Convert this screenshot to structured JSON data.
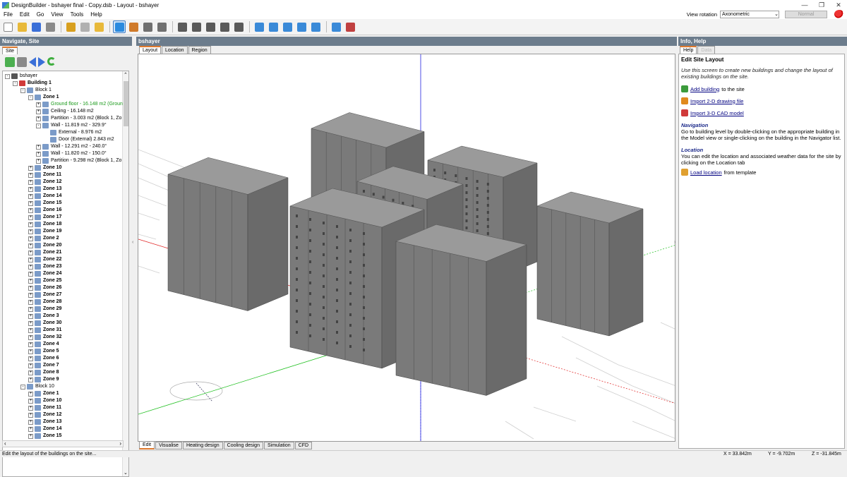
{
  "window": {
    "title": "DesignBuilder - bshayer final - Copy.dsb - Layout - bshayer",
    "controls": [
      "minimize-icon",
      "maximize-icon",
      "close-icon"
    ]
  },
  "menu": [
    "File",
    "Edit",
    "Go",
    "View",
    "Tools",
    "Help"
  ],
  "view_rotation": {
    "label": "View rotation",
    "value": "Axonometric",
    "mode_button": "Normal"
  },
  "toolbar": {
    "icons": [
      "new-icon",
      "open-icon",
      "save-icon",
      "print-icon",
      "wrench-icon",
      "eraser-icon",
      "lock-icon",
      "select-arrow-icon",
      "add-building-icon",
      "move-icon",
      "rotate-icon",
      "draw-line-icon",
      "measure-icon",
      "dimension-icon",
      "ruler-icon",
      "axis-icon",
      "orbit-icon",
      "zoom-in-icon",
      "zoom-window-icon",
      "zoom-extents-icon",
      "zoom-fit-icon",
      "screenshot-icon",
      "render-icon"
    ],
    "active_index": 7
  },
  "left_panel": {
    "header": "Navigate, Site",
    "tab": "Site",
    "tree": [
      {
        "depth": 0,
        "label": "bshayer",
        "exp": "-",
        "bold": false
      },
      {
        "depth": 1,
        "label": "Building 1",
        "exp": "-",
        "bold": true
      },
      {
        "depth": 2,
        "label": "Block 1",
        "exp": "-",
        "bold": false
      },
      {
        "depth": 3,
        "label": "Zone 1",
        "exp": "-",
        "bold": true
      },
      {
        "depth": 4,
        "label": "Ground floor - 16.148 m2 (Groun",
        "exp": "+",
        "bold": false,
        "green": true
      },
      {
        "depth": 4,
        "label": "Ceiling - 16.148 m2",
        "exp": "+",
        "bold": false
      },
      {
        "depth": 4,
        "label": "Partition - 3.003 m2 (Block 1, Zo",
        "exp": "+",
        "bold": false
      },
      {
        "depth": 4,
        "label": "Wall - 11.819 m2 - 329.9°",
        "exp": "-",
        "bold": false
      },
      {
        "depth": 5,
        "label": "External - 8.976 m2",
        "exp": "",
        "bold": false
      },
      {
        "depth": 5,
        "label": "Door (External) 2.843 m2",
        "exp": "",
        "bold": false
      },
      {
        "depth": 4,
        "label": "Wall - 12.291 m2 - 240.0°",
        "exp": "+",
        "bold": false
      },
      {
        "depth": 4,
        "label": "Wall - 11.820 m2 - 150.0°",
        "exp": "+",
        "bold": false
      },
      {
        "depth": 4,
        "label": "Partition - 9.298 m2 (Block 1, Zo",
        "exp": "+",
        "bold": false
      },
      {
        "depth": 3,
        "label": "Zone 10",
        "exp": "+",
        "bold": true
      },
      {
        "depth": 3,
        "label": "Zone 11",
        "exp": "+",
        "bold": true
      },
      {
        "depth": 3,
        "label": "Zone 12",
        "exp": "+",
        "bold": true
      },
      {
        "depth": 3,
        "label": "Zone 13",
        "exp": "+",
        "bold": true
      },
      {
        "depth": 3,
        "label": "Zone 14",
        "exp": "+",
        "bold": true
      },
      {
        "depth": 3,
        "label": "Zone 15",
        "exp": "+",
        "bold": true
      },
      {
        "depth": 3,
        "label": "Zone 16",
        "exp": "+",
        "bold": true
      },
      {
        "depth": 3,
        "label": "Zone 17",
        "exp": "+",
        "bold": true
      },
      {
        "depth": 3,
        "label": "Zone 18",
        "exp": "+",
        "bold": true
      },
      {
        "depth": 3,
        "label": "Zone 19",
        "exp": "+",
        "bold": true
      },
      {
        "depth": 3,
        "label": "Zone 2",
        "exp": "+",
        "bold": true
      },
      {
        "depth": 3,
        "label": "Zone 20",
        "exp": "+",
        "bold": true
      },
      {
        "depth": 3,
        "label": "Zone 21",
        "exp": "+",
        "bold": true
      },
      {
        "depth": 3,
        "label": "Zone 22",
        "exp": "+",
        "bold": true
      },
      {
        "depth": 3,
        "label": "Zone 23",
        "exp": "+",
        "bold": true
      },
      {
        "depth": 3,
        "label": "Zone 24",
        "exp": "+",
        "bold": true
      },
      {
        "depth": 3,
        "label": "Zone 25",
        "exp": "+",
        "bold": true
      },
      {
        "depth": 3,
        "label": "Zone 26",
        "exp": "+",
        "bold": true
      },
      {
        "depth": 3,
        "label": "Zone 27",
        "exp": "+",
        "bold": true
      },
      {
        "depth": 3,
        "label": "Zone 28",
        "exp": "+",
        "bold": true
      },
      {
        "depth": 3,
        "label": "Zone 29",
        "exp": "+",
        "bold": true
      },
      {
        "depth": 3,
        "label": "Zone 3",
        "exp": "+",
        "bold": true
      },
      {
        "depth": 3,
        "label": "Zone 30",
        "exp": "+",
        "bold": true
      },
      {
        "depth": 3,
        "label": "Zone 31",
        "exp": "+",
        "bold": true
      },
      {
        "depth": 3,
        "label": "Zone 32",
        "exp": "+",
        "bold": true
      },
      {
        "depth": 3,
        "label": "Zone 4",
        "exp": "+",
        "bold": true
      },
      {
        "depth": 3,
        "label": "Zone 5",
        "exp": "+",
        "bold": true
      },
      {
        "depth": 3,
        "label": "Zone 6",
        "exp": "+",
        "bold": true
      },
      {
        "depth": 3,
        "label": "Zone 7",
        "exp": "+",
        "bold": true
      },
      {
        "depth": 3,
        "label": "Zone 8",
        "exp": "+",
        "bold": true
      },
      {
        "depth": 3,
        "label": "Zone 9",
        "exp": "+",
        "bold": true
      },
      {
        "depth": 2,
        "label": "Block 10",
        "exp": "-",
        "bold": false
      },
      {
        "depth": 3,
        "label": "Zone 1",
        "exp": "+",
        "bold": true
      },
      {
        "depth": 3,
        "label": "Zone 10",
        "exp": "+",
        "bold": true
      },
      {
        "depth": 3,
        "label": "Zone 11",
        "exp": "+",
        "bold": true
      },
      {
        "depth": 3,
        "label": "Zone 12",
        "exp": "+",
        "bold": true
      },
      {
        "depth": 3,
        "label": "Zone 13",
        "exp": "+",
        "bold": true
      },
      {
        "depth": 3,
        "label": "Zone 14",
        "exp": "+",
        "bold": true
      },
      {
        "depth": 3,
        "label": "Zone 15",
        "exp": "+",
        "bold": true
      }
    ]
  },
  "center_panel": {
    "header": "bshayer",
    "tabs": [
      "Layout",
      "Location",
      "Region"
    ],
    "active_tab": 0,
    "bottom_tabs": [
      "Edit",
      "Visualise",
      "Heating design",
      "Cooling design",
      "Simulation",
      "CFD"
    ],
    "active_bottom_tab": 0
  },
  "right_panel": {
    "header": "Info, Help",
    "tabs": [
      "Help",
      "Data"
    ],
    "title": "Edit Site Layout",
    "intro": "Use this screen to create new buildings and change the layout of existing buildings on the site.",
    "links": [
      {
        "link": "Add building",
        "rest": "to the site",
        "icon": "add-building-icon"
      },
      {
        "link": "Import 2-D drawing file",
        "rest": "",
        "icon": "import-2d-icon"
      },
      {
        "link": "Import 3-D CAD model",
        "rest": "",
        "icon": "import-3d-icon"
      }
    ],
    "navigation_title": "Navigation",
    "navigation_text": "Go to building level by double-clicking on the appropriate building in the Model view or single-clicking on the building in the Navigator list.",
    "location_title": "Location",
    "location_text": "You can edit the location and associated weather data for the site by clicking on the Location tab",
    "location_link": "Load location",
    "location_rest": "from template"
  },
  "status": {
    "message": "Edit the layout of the buildings on the site...",
    "x": "X = 33.842m",
    "y": "Y = -9.702m",
    "z": "Z = -31.845m"
  },
  "colors": {
    "panel_header": "#6c7c8c",
    "building": "#7a7a7a",
    "axis_x": "#e02020",
    "axis_y": "#20c020",
    "axis_z": "#2020e0"
  }
}
